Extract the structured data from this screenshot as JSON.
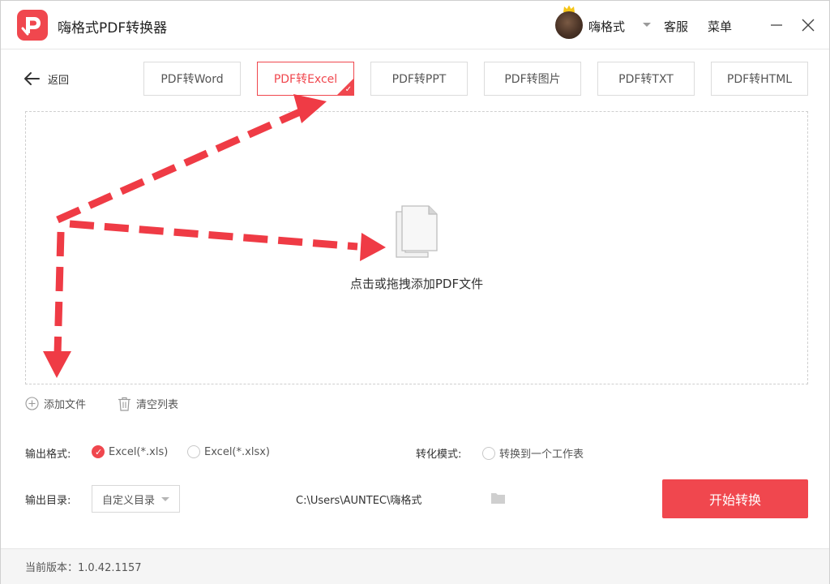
{
  "app": {
    "title": "嗨格式PDF转换器",
    "brand_color": "#f0474e"
  },
  "header": {
    "username": "嗨格式",
    "service_label": "客服",
    "menu_label": "菜单"
  },
  "nav": {
    "back_label": "返回"
  },
  "tabs": [
    {
      "label": "PDF转Word",
      "active": false
    },
    {
      "label": "PDF转Excel",
      "active": true
    },
    {
      "label": "PDF转PPT",
      "active": false
    },
    {
      "label": "PDF转图片",
      "active": false
    },
    {
      "label": "PDF转TXT",
      "active": false
    },
    {
      "label": "PDF转HTML",
      "active": false
    }
  ],
  "dropzone": {
    "hint": "点击或拖拽添加PDF文件"
  },
  "actions": {
    "add_file_label": "添加文件",
    "clear_list_label": "清空列表"
  },
  "output_format": {
    "label": "输出格式:",
    "options": [
      {
        "label": "Excel(*.xls)",
        "selected": true
      },
      {
        "label": "Excel(*.xlsx)",
        "selected": false
      }
    ]
  },
  "conversion_mode": {
    "label": "转化模式:",
    "option_label": "转换到一个工作表",
    "selected": false
  },
  "output_dir": {
    "label": "输出目录:",
    "select_value": "自定义目录",
    "path": "C:\\Users\\AUNTEC\\嗨格式"
  },
  "start_button_label": "开始转换",
  "footer": {
    "version_text": "当前版本：1.0.42.1157"
  },
  "icons": {
    "logo": "pdf-logo-icon",
    "back": "arrow-left-icon",
    "file": "file-stack-icon",
    "add": "plus-circle-icon",
    "clear": "trash-icon",
    "folder": "folder-icon",
    "minimize": "minimize-icon",
    "close": "close-icon",
    "dropdown": "chevron-down-icon"
  },
  "annotation_color": "#ef3b45"
}
